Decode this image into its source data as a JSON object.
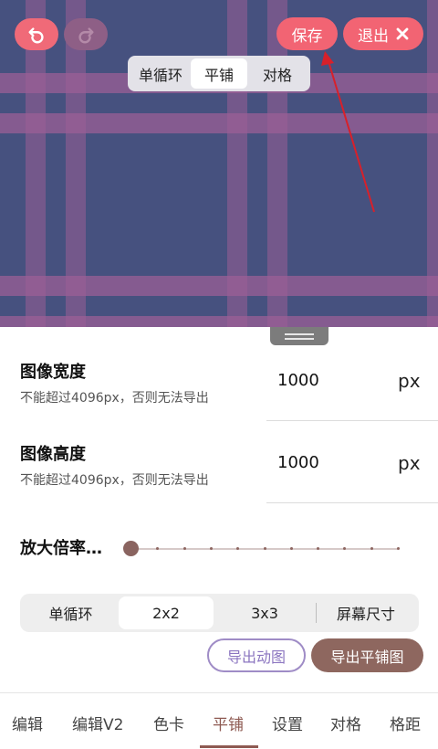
{
  "toolbar": {
    "undo_icon": "undo-icon",
    "redo_icon": "redo-icon",
    "save_label": "保存",
    "exit_label": "退出",
    "exit_icon": "close-icon"
  },
  "mode_tabs": [
    {
      "label": "单循环",
      "active": false
    },
    {
      "label": "平铺",
      "active": true
    },
    {
      "label": "对格",
      "active": false
    }
  ],
  "colors": {
    "plaid_base": "#46517f",
    "plaid_stripe": "#8a5d8f",
    "accent_pink": "#f26473",
    "accent_brown": "#8e675f",
    "accent_purple": "#8b75c0",
    "annotation_arrow": "#d8202a"
  },
  "settings": {
    "width": {
      "title": "图像宽度",
      "hint": "不能超过4096px，否则无法导出",
      "value": "1000",
      "unit": "px"
    },
    "height": {
      "title": "图像高度",
      "hint": "不能超过4096px，否则无法导出",
      "value": "1000",
      "unit": "px"
    },
    "zoom": {
      "label": "放大倍率…",
      "value_fraction": 0.0,
      "steps": 10
    }
  },
  "grid_options": [
    {
      "label": "单循环",
      "active": false
    },
    {
      "label": "2x2",
      "active": true
    },
    {
      "label": "3x3",
      "active": false
    },
    {
      "label": "屏幕尺寸",
      "active": false
    }
  ],
  "actions": {
    "export_anim": "导出动图",
    "export_tile": "导出平铺图"
  },
  "nav_tabs": [
    {
      "label": "编辑",
      "active": false
    },
    {
      "label": "编辑V2",
      "active": false
    },
    {
      "label": "色卡",
      "active": false
    },
    {
      "label": "平铺",
      "active": true
    },
    {
      "label": "设置",
      "active": false
    },
    {
      "label": "对格",
      "active": false
    },
    {
      "label": "格距",
      "active": false
    }
  ]
}
